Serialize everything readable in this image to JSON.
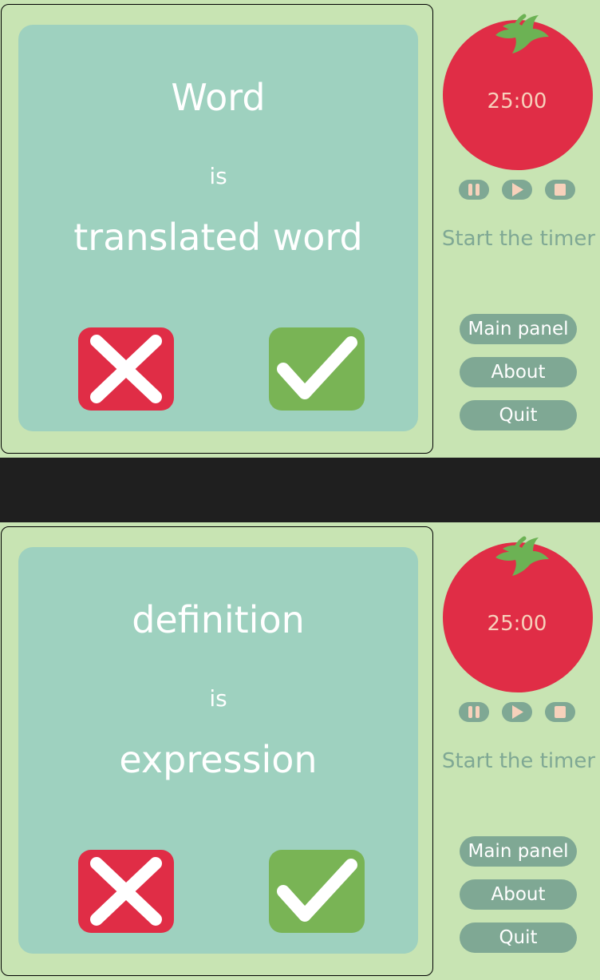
{
  "screens": [
    {
      "card": {
        "word": "Word",
        "connector": "is",
        "translation": "translated word"
      },
      "sidebar": {
        "timer": "25:00",
        "status": "Start the timer",
        "nav": {
          "main_panel": "Main panel",
          "about": "About",
          "quit": "Quit"
        }
      }
    },
    {
      "card": {
        "word": "definition",
        "connector": "is",
        "translation": "expression"
      },
      "sidebar": {
        "timer": "25:00",
        "status": "Start the timer",
        "nav": {
          "main_panel": "Main panel",
          "about": "About",
          "quit": "Quit"
        }
      }
    }
  ],
  "icons": {
    "wrong": "close-icon",
    "right": "check-icon",
    "tomato": "tomato-icon",
    "pause": "pause-icon",
    "play": "play-icon",
    "stop": "stop-icon"
  },
  "colors": {
    "background": "#c8e4b3",
    "card": "#9ed1bf",
    "wrong": "#e02d46",
    "right": "#79b455",
    "tomato": "#e02d46",
    "leaf": "#6cb254",
    "control": "#7fa894",
    "control_glyph": "#f7d1bb"
  }
}
